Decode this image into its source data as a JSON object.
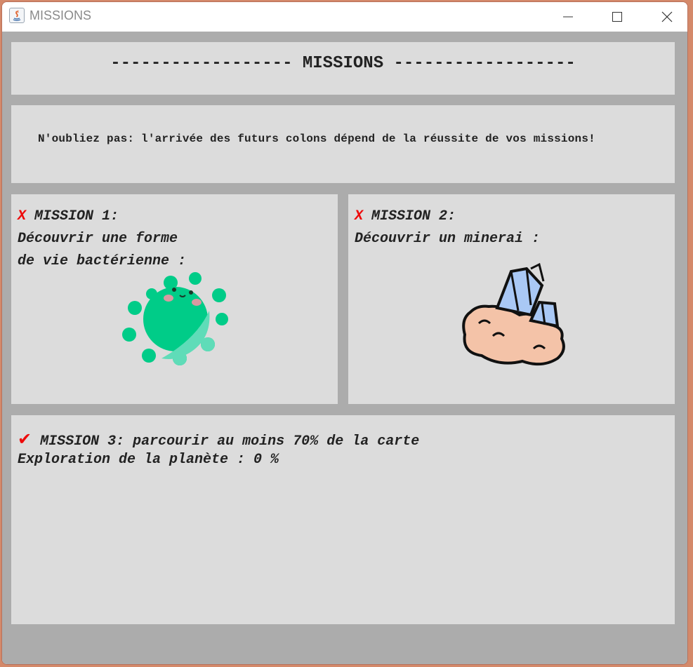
{
  "window": {
    "title": "MISSIONS"
  },
  "header": {
    "title": "------------------ MISSIONS ------------------"
  },
  "reminder": {
    "text": "N'oubliez pas: l'arrivée des futurs colons dépend de la réussite de vos missions!"
  },
  "missions": [
    {
      "status_icon": "✗-icon",
      "status_mark": "X",
      "title": "MISSION 1:",
      "line1": "Découvrir une forme",
      "line2": "de vie bactérienne :",
      "image_icon": "bacteria-icon"
    },
    {
      "status_icon": "✗-icon",
      "status_mark": "X",
      "title": "MISSION 2:",
      "line1": "Découvrir un minerai :",
      "image_icon": "crystal-ore-icon"
    },
    {
      "status_icon": "checkmark-icon",
      "status_mark": "✔",
      "title": "MISSION 3: parcourir au moins 70% de la carte",
      "progress_text": "Exploration de la planète : 0 %"
    }
  ],
  "colors": {
    "fail_mark": "#ee0a0a",
    "panel_bg": "#dcdcdc",
    "frame_bg": "#acacac",
    "bacteria_dark": "#00cc88",
    "bacteria_light": "#5fdcb8",
    "crystal": "#a9c8f5",
    "rock": "#f4c3a8"
  }
}
